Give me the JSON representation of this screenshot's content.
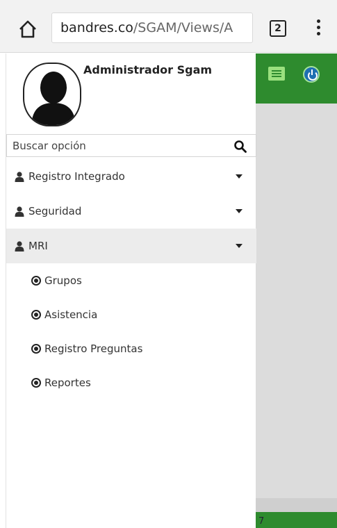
{
  "browser": {
    "url_domain": "bandres.co",
    "url_path": "/SGAM/Views/A",
    "tab_count": "2",
    "icons": {
      "home": "home-icon",
      "menu": "kebab-menu-icon"
    }
  },
  "app": {
    "footer_text": "7",
    "colors": {
      "primary": "#2e8b2e",
      "background": "#dcdcdc"
    },
    "icons": {
      "messages": "message-list-icon",
      "power": "power-icon"
    }
  },
  "drawer": {
    "user_name": "Administrador Sgam",
    "search": {
      "placeholder": "Buscar opción"
    },
    "menu": [
      {
        "label": "Registro Integrado",
        "icon": "user-icon",
        "expanded": false
      },
      {
        "label": "Seguridad",
        "icon": "user-icon",
        "expanded": false
      },
      {
        "label": "MRI",
        "icon": "user-icon",
        "expanded": true,
        "children": [
          {
            "label": "Grupos"
          },
          {
            "label": "Asistencia"
          },
          {
            "label": "Registro Preguntas"
          },
          {
            "label": "Reportes"
          }
        ]
      }
    ]
  }
}
